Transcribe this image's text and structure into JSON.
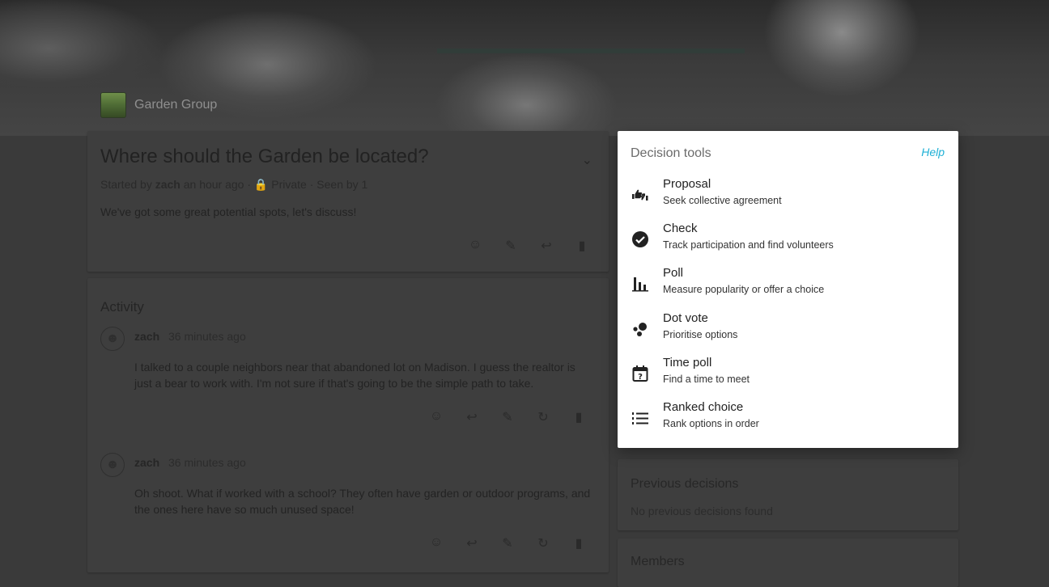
{
  "group": {
    "name": "Garden Group"
  },
  "thread": {
    "title": "Where should the Garden be located?",
    "meta_prefix": "Started by",
    "author": "zach",
    "meta_time": "an hour ago",
    "privacy": "Private",
    "seen_by": "Seen by 1",
    "body": "We've got some great potential spots, let's discuss!"
  },
  "activity": {
    "label": "Activity",
    "comments": [
      {
        "author": "zach",
        "time": "36 minutes ago",
        "body": "I talked to a couple neighbors near that abandoned lot on Madison. I guess the realtor is just a bear to work with. I'm not sure if that's going to be the simple path to take."
      },
      {
        "author": "zach",
        "time": "36 minutes ago",
        "body": "Oh shoot. What if worked with a school? They often have garden or outdoor programs, and the ones here have so much unused space!"
      }
    ]
  },
  "sidebar": {
    "previous_title": "Previous decisions",
    "previous_empty": "No previous decisions found",
    "members_title": "Members"
  },
  "decision_tools": {
    "title": "Decision tools",
    "help": "Help",
    "tools": [
      {
        "name": "Proposal",
        "description": "Seek collective agreement",
        "icon": "thumbs-up-down-icon"
      },
      {
        "name": "Check",
        "description": "Track participation and find volunteers",
        "icon": "check-circle-icon"
      },
      {
        "name": "Poll",
        "description": "Measure popularity or offer a choice",
        "icon": "bar-chart-icon"
      },
      {
        "name": "Dot vote",
        "description": "Prioritise options",
        "icon": "dots-icon"
      },
      {
        "name": "Time poll",
        "description": "Find a time to meet",
        "icon": "calendar-question-icon"
      },
      {
        "name": "Ranked choice",
        "description": "Rank options in order",
        "icon": "numbered-list-icon"
      }
    ]
  },
  "colors": {
    "accent": "#1fb0d6",
    "overlay": "#3a3a3a",
    "menu_bg": "#ffffff"
  }
}
